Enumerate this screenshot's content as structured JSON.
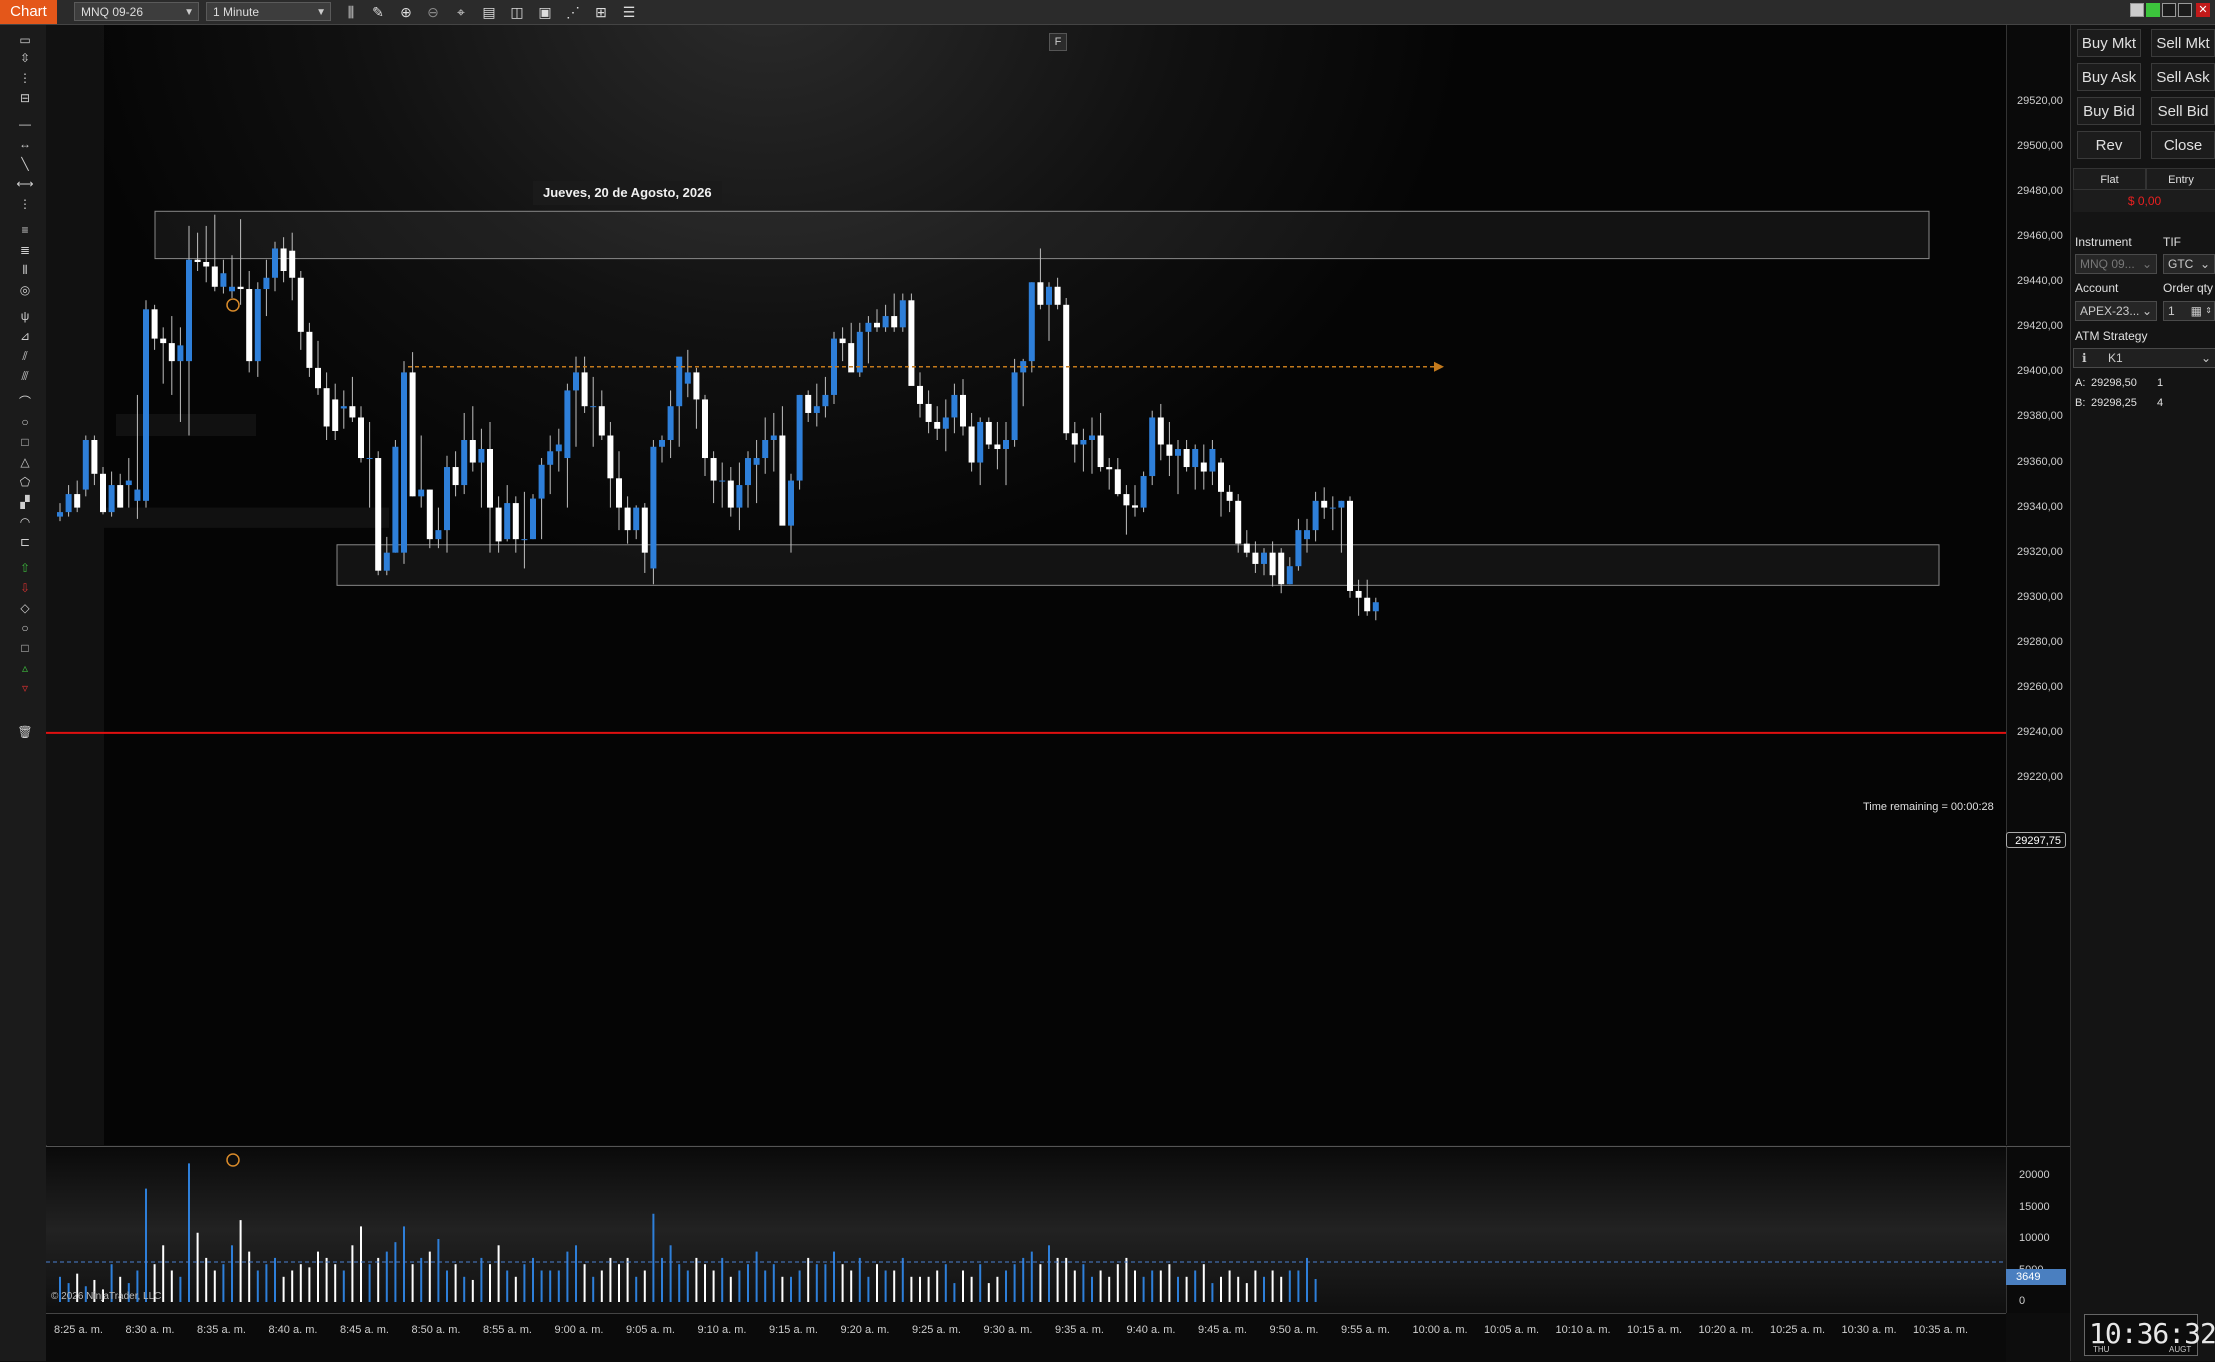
{
  "topbar": {
    "chart_tab": "Chart",
    "instrument": "MNQ 09-26",
    "interval": "1 Minute"
  },
  "chart": {
    "date_label": "Jueves, 20 de Agosto, 2026",
    "time_remaining": "Time remaining = 00:00:28",
    "last_price": "29297,75",
    "copyright": "© 2026 NinjaTrader, LLC",
    "f_button": "F",
    "price_ticks": [
      "29520,00",
      "29500,00",
      "29480,00",
      "29460,00",
      "29440,00",
      "29420,00",
      "29400,00",
      "29380,00",
      "29360,00",
      "29340,00",
      "29320,00",
      "29300,00",
      "29280,00",
      "29260,00",
      "29240,00",
      "29220,00"
    ],
    "volume_ticks": [
      "20000",
      "15000",
      "10000",
      "5000",
      "0"
    ],
    "volume_last": "3649",
    "time_ticks": [
      "8:25 a. m.",
      "8:30 a. m.",
      "8:35 a. m.",
      "8:40 a. m.",
      "8:45 a. m.",
      "8:50 a. m.",
      "8:55 a. m.",
      "9:00 a. m.",
      "9:05 a. m.",
      "9:10 a. m.",
      "9:15 a. m.",
      "9:20 a. m.",
      "9:25 a. m.",
      "9:30 a. m.",
      "9:35 a. m.",
      "9:40 a. m.",
      "9:45 a. m.",
      "9:50 a. m.",
      "9:55 a. m.",
      "10:00 a. m.",
      "10:05 a. m.",
      "10:10 a. m.",
      "10:15 a. m.",
      "10:20 a. m.",
      "10:25 a. m.",
      "10:30 a. m.",
      "10:35 a. m."
    ],
    "colors": {
      "up": "#2e7fd9",
      "down": "#ffffff",
      "stop_line": "#e01010",
      "zone": "#888888",
      "arrow": "#c47a1c"
    },
    "levels": {
      "red_line": 29240.0,
      "arrow_level": 29402.5,
      "top_zone": [
        29450.5,
        29471.5
      ],
      "bottom_zone": [
        29305.5,
        29323.5
      ],
      "left_zone": [
        29331,
        29340
      ]
    }
  },
  "chart_data": {
    "type": "candlestick",
    "price_range": [
      29210,
      29530
    ],
    "volume_range": [
      0,
      22000
    ],
    "candles": [
      {
        "o": 29336,
        "h": 29342,
        "l": 29334,
        "c": 29338
      },
      {
        "o": 29338,
        "h": 29350,
        "l": 29336,
        "c": 29346
      },
      {
        "o": 29346,
        "h": 29352,
        "l": 29338,
        "c": 29340
      },
      {
        "o": 29348,
        "h": 29372,
        "l": 29345,
        "c": 29370
      },
      {
        "o": 29370,
        "h": 29372,
        "l": 29350,
        "c": 29355
      },
      {
        "o": 29355,
        "h": 29358,
        "l": 29337,
        "c": 29338
      },
      {
        "o": 29338,
        "h": 29356,
        "l": 29336,
        "c": 29350
      },
      {
        "o": 29350,
        "h": 29355,
        "l": 29340,
        "c": 29340
      },
      {
        "o": 29350,
        "h": 29362,
        "l": 29340,
        "c": 29352
      },
      {
        "o": 29343,
        "h": 29390,
        "l": 29335,
        "c": 29348
      },
      {
        "o": 29343,
        "h": 29432,
        "l": 29340,
        "c": 29428
      },
      {
        "o": 29428,
        "h": 29430,
        "l": 29410,
        "c": 29415
      },
      {
        "o": 29415,
        "h": 29420,
        "l": 29395,
        "c": 29413
      },
      {
        "o": 29413,
        "h": 29425,
        "l": 29390,
        "c": 29405
      },
      {
        "o": 29405,
        "h": 29420,
        "l": 29378,
        "c": 29412
      },
      {
        "o": 29405,
        "h": 29465,
        "l": 29372,
        "c": 29450
      },
      {
        "o": 29450,
        "h": 29462,
        "l": 29445,
        "c": 29449
      },
      {
        "o": 29449,
        "h": 29465,
        "l": 29440,
        "c": 29447
      },
      {
        "o": 29447,
        "h": 29470,
        "l": 29436,
        "c": 29438
      },
      {
        "o": 29438,
        "h": 29450,
        "l": 29435,
        "c": 29444
      },
      {
        "o": 29436,
        "h": 29452,
        "l": 29433,
        "c": 29438
      },
      {
        "o": 29438,
        "h": 29468,
        "l": 29430,
        "c": 29437
      },
      {
        "o": 29437,
        "h": 29445,
        "l": 29400,
        "c": 29405
      },
      {
        "o": 29405,
        "h": 29440,
        "l": 29398,
        "c": 29437
      },
      {
        "o": 29437,
        "h": 29450,
        "l": 29425,
        "c": 29442
      },
      {
        "o": 29442,
        "h": 29458,
        "l": 29436,
        "c": 29455
      },
      {
        "o": 29455,
        "h": 29460,
        "l": 29440,
        "c": 29445
      },
      {
        "o": 29454,
        "h": 29462,
        "l": 29432,
        "c": 29442
      },
      {
        "o": 29442,
        "h": 29445,
        "l": 29410,
        "c": 29418
      },
      {
        "o": 29418,
        "h": 29422,
        "l": 29398,
        "c": 29402
      },
      {
        "o": 29402,
        "h": 29414,
        "l": 29390,
        "c": 29393
      },
      {
        "o": 29393,
        "h": 29400,
        "l": 29370,
        "c": 29376
      },
      {
        "o": 29388,
        "h": 29395,
        "l": 29370,
        "c": 29374
      },
      {
        "o": 29384,
        "h": 29392,
        "l": 29375,
        "c": 29385
      },
      {
        "o": 29385,
        "h": 29398,
        "l": 29378,
        "c": 29380
      },
      {
        "o": 29380,
        "h": 29385,
        "l": 29360,
        "c": 29362
      },
      {
        "o": 29362,
        "h": 29378,
        "l": 29340,
        "c": 29362
      },
      {
        "o": 29362,
        "h": 29365,
        "l": 29310,
        "c": 29312
      },
      {
        "o": 29312,
        "h": 29327,
        "l": 29310,
        "c": 29320
      },
      {
        "o": 29320,
        "h": 29370,
        "l": 29320,
        "c": 29367
      },
      {
        "o": 29320,
        "h": 29405,
        "l": 29315,
        "c": 29400
      },
      {
        "o": 29400,
        "h": 29409,
        "l": 29345,
        "c": 29345
      },
      {
        "o": 29345,
        "h": 29372,
        "l": 29340,
        "c": 29348
      },
      {
        "o": 29348,
        "h": 29348,
        "l": 29322,
        "c": 29326
      },
      {
        "o": 29326,
        "h": 29340,
        "l": 29322,
        "c": 29330
      },
      {
        "o": 29330,
        "h": 29363,
        "l": 29320,
        "c": 29358
      },
      {
        "o": 29358,
        "h": 29365,
        "l": 29345,
        "c": 29350
      },
      {
        "o": 29350,
        "h": 29382,
        "l": 29346,
        "c": 29370
      },
      {
        "o": 29370,
        "h": 29385,
        "l": 29356,
        "c": 29360
      },
      {
        "o": 29360,
        "h": 29375,
        "l": 29340,
        "c": 29366
      },
      {
        "o": 29366,
        "h": 29378,
        "l": 29320,
        "c": 29340
      },
      {
        "o": 29340,
        "h": 29345,
        "l": 29320,
        "c": 29325
      },
      {
        "o": 29326,
        "h": 29350,
        "l": 29325,
        "c": 29342
      },
      {
        "o": 29342,
        "h": 29345,
        "l": 29320,
        "c": 29326
      },
      {
        "o": 29326,
        "h": 29347,
        "l": 29313,
        "c": 29326
      },
      {
        "o": 29326,
        "h": 29346,
        "l": 29326,
        "c": 29344
      },
      {
        "o": 29344,
        "h": 29362,
        "l": 29326,
        "c": 29359
      },
      {
        "o": 29359,
        "h": 29372,
        "l": 29346,
        "c": 29365
      },
      {
        "o": 29365,
        "h": 29375,
        "l": 29356,
        "c": 29368
      },
      {
        "o": 29362,
        "h": 29395,
        "l": 29340,
        "c": 29392
      },
      {
        "o": 29392,
        "h": 29407,
        "l": 29367,
        "c": 29400
      },
      {
        "o": 29400,
        "h": 29407,
        "l": 29382,
        "c": 29385
      },
      {
        "o": 29385,
        "h": 29398,
        "l": 29367,
        "c": 29385
      },
      {
        "o": 29385,
        "h": 29392,
        "l": 29370,
        "c": 29372
      },
      {
        "o": 29372,
        "h": 29378,
        "l": 29340,
        "c": 29353
      },
      {
        "o": 29353,
        "h": 29365,
        "l": 29330,
        "c": 29340
      },
      {
        "o": 29340,
        "h": 29345,
        "l": 29324,
        "c": 29330
      },
      {
        "o": 29330,
        "h": 29341,
        "l": 29326,
        "c": 29340
      },
      {
        "o": 29340,
        "h": 29342,
        "l": 29311,
        "c": 29320
      },
      {
        "o": 29313,
        "h": 29370,
        "l": 29306,
        "c": 29367
      },
      {
        "o": 29367,
        "h": 29372,
        "l": 29360,
        "c": 29370
      },
      {
        "o": 29370,
        "h": 29392,
        "l": 29362,
        "c": 29385
      },
      {
        "o": 29385,
        "h": 29400,
        "l": 29367,
        "c": 29407
      },
      {
        "o": 29395,
        "h": 29410,
        "l": 29389,
        "c": 29400
      },
      {
        "o": 29400,
        "h": 29402,
        "l": 29375,
        "c": 29388
      },
      {
        "o": 29388,
        "h": 29390,
        "l": 29354,
        "c": 29362
      },
      {
        "o": 29362,
        "h": 29365,
        "l": 29342,
        "c": 29352
      },
      {
        "o": 29352,
        "h": 29360,
        "l": 29340,
        "c": 29352
      },
      {
        "o": 29352,
        "h": 29358,
        "l": 29336,
        "c": 29340
      },
      {
        "o": 29340,
        "h": 29360,
        "l": 29330,
        "c": 29350
      },
      {
        "o": 29350,
        "h": 29365,
        "l": 29340,
        "c": 29362
      },
      {
        "o": 29359,
        "h": 29370,
        "l": 29342,
        "c": 29362
      },
      {
        "o": 29362,
        "h": 29380,
        "l": 29355,
        "c": 29370
      },
      {
        "o": 29370,
        "h": 29382,
        "l": 29356,
        "c": 29372
      },
      {
        "o": 29372,
        "h": 29385,
        "l": 29336,
        "c": 29332
      },
      {
        "o": 29332,
        "h": 29355,
        "l": 29320,
        "c": 29352
      },
      {
        "o": 29352,
        "h": 29390,
        "l": 29348,
        "c": 29390
      },
      {
        "o": 29390,
        "h": 29392,
        "l": 29378,
        "c": 29382
      },
      {
        "o": 29382,
        "h": 29395,
        "l": 29376,
        "c": 29385
      },
      {
        "o": 29385,
        "h": 29398,
        "l": 29380,
        "c": 29390
      },
      {
        "o": 29390,
        "h": 29418,
        "l": 29386,
        "c": 29415
      },
      {
        "o": 29415,
        "h": 29420,
        "l": 29405,
        "c": 29413
      },
      {
        "o": 29413,
        "h": 29422,
        "l": 29403,
        "c": 29400
      },
      {
        "o": 29400,
        "h": 29422,
        "l": 29398,
        "c": 29418
      },
      {
        "o": 29418,
        "h": 29425,
        "l": 29404,
        "c": 29422
      },
      {
        "o": 29422,
        "h": 29428,
        "l": 29418,
        "c": 29420
      },
      {
        "o": 29420,
        "h": 29430,
        "l": 29418,
        "c": 29425
      },
      {
        "o": 29425,
        "h": 29435,
        "l": 29418,
        "c": 29420
      },
      {
        "o": 29420,
        "h": 29435,
        "l": 29418,
        "c": 29432
      },
      {
        "o": 29432,
        "h": 29435,
        "l": 29400,
        "c": 29394
      },
      {
        "o": 29394,
        "h": 29400,
        "l": 29380,
        "c": 29386
      },
      {
        "o": 29386,
        "h": 29392,
        "l": 29373,
        "c": 29378
      },
      {
        "o": 29378,
        "h": 29385,
        "l": 29370,
        "c": 29375
      },
      {
        "o": 29375,
        "h": 29388,
        "l": 29365,
        "c": 29380
      },
      {
        "o": 29380,
        "h": 29395,
        "l": 29373,
        "c": 29390
      },
      {
        "o": 29390,
        "h": 29397,
        "l": 29372,
        "c": 29376
      },
      {
        "o": 29376,
        "h": 29382,
        "l": 29356,
        "c": 29360
      },
      {
        "o": 29360,
        "h": 29380,
        "l": 29350,
        "c": 29378
      },
      {
        "o": 29378,
        "h": 29380,
        "l": 29366,
        "c": 29368
      },
      {
        "o": 29368,
        "h": 29378,
        "l": 29357,
        "c": 29366
      },
      {
        "o": 29366,
        "h": 29378,
        "l": 29350,
        "c": 29370
      },
      {
        "o": 29370,
        "h": 29406,
        "l": 29367,
        "c": 29400
      },
      {
        "o": 29400,
        "h": 29406,
        "l": 29385,
        "c": 29405
      },
      {
        "o": 29405,
        "h": 29440,
        "l": 29400,
        "c": 29440
      },
      {
        "o": 29440,
        "h": 29455,
        "l": 29428,
        "c": 29430
      },
      {
        "o": 29430,
        "h": 29440,
        "l": 29414,
        "c": 29438
      },
      {
        "o": 29438,
        "h": 29442,
        "l": 29428,
        "c": 29430
      },
      {
        "o": 29430,
        "h": 29433,
        "l": 29370,
        "c": 29373
      },
      {
        "o": 29373,
        "h": 29378,
        "l": 29360,
        "c": 29368
      },
      {
        "o": 29368,
        "h": 29375,
        "l": 29356,
        "c": 29370
      },
      {
        "o": 29370,
        "h": 29380,
        "l": 29355,
        "c": 29372
      },
      {
        "o": 29372,
        "h": 29382,
        "l": 29356,
        "c": 29358
      },
      {
        "o": 29358,
        "h": 29362,
        "l": 29348,
        "c": 29357
      },
      {
        "o": 29357,
        "h": 29362,
        "l": 29345,
        "c": 29346
      },
      {
        "o": 29346,
        "h": 29350,
        "l": 29328,
        "c": 29341
      },
      {
        "o": 29341,
        "h": 29350,
        "l": 29336,
        "c": 29340
      },
      {
        "o": 29340,
        "h": 29356,
        "l": 29338,
        "c": 29354
      },
      {
        "o": 29354,
        "h": 29383,
        "l": 29350,
        "c": 29380
      },
      {
        "o": 29380,
        "h": 29386,
        "l": 29361,
        "c": 29368
      },
      {
        "o": 29368,
        "h": 29378,
        "l": 29354,
        "c": 29363
      },
      {
        "o": 29363,
        "h": 29370,
        "l": 29346,
        "c": 29366
      },
      {
        "o": 29366,
        "h": 29370,
        "l": 29356,
        "c": 29358
      },
      {
        "o": 29358,
        "h": 29368,
        "l": 29348,
        "c": 29366
      },
      {
        "o": 29360,
        "h": 29368,
        "l": 29348,
        "c": 29356
      },
      {
        "o": 29356,
        "h": 29370,
        "l": 29350,
        "c": 29366
      },
      {
        "o": 29360,
        "h": 29362,
        "l": 29336,
        "c": 29347
      },
      {
        "o": 29347,
        "h": 29350,
        "l": 29338,
        "c": 29343
      },
      {
        "o": 29343,
        "h": 29346,
        "l": 29320,
        "c": 29324
      },
      {
        "o": 29324,
        "h": 29330,
        "l": 29318,
        "c": 29320
      },
      {
        "o": 29320,
        "h": 29325,
        "l": 29311,
        "c": 29315
      },
      {
        "o": 29315,
        "h": 29322,
        "l": 29310,
        "c": 29320
      },
      {
        "o": 29320,
        "h": 29325,
        "l": 29305,
        "c": 29310
      },
      {
        "o": 29320,
        "h": 29322,
        "l": 29302,
        "c": 29306
      },
      {
        "o": 29306,
        "h": 29318,
        "l": 29306,
        "c": 29314
      },
      {
        "o": 29314,
        "h": 29335,
        "l": 29312,
        "c": 29330
      },
      {
        "o": 29326,
        "h": 29335,
        "l": 29320,
        "c": 29330
      },
      {
        "o": 29330,
        "h": 29347,
        "l": 29325,
        "c": 29343
      },
      {
        "o": 29343,
        "h": 29349,
        "l": 29335,
        "c": 29340
      },
      {
        "o": 29340,
        "h": 29345,
        "l": 29330,
        "c": 29340
      },
      {
        "o": 29340,
        "h": 29343,
        "l": 29320,
        "c": 29343
      },
      {
        "o": 29343,
        "h": 29345,
        "l": 29300,
        "c": 29303
      },
      {
        "o": 29303,
        "h": 29308,
        "l": 29292,
        "c": 29300
      },
      {
        "o": 29300,
        "h": 29308,
        "l": 29292,
        "c": 29294
      },
      {
        "o": 29294,
        "h": 29300,
        "l": 29290,
        "c": 29298
      }
    ],
    "volumes": [
      4000,
      3000,
      4500,
      2500,
      3500,
      2000,
      6000,
      4000,
      3000,
      5000,
      18000,
      6000,
      9000,
      5000,
      4000,
      22000,
      11000,
      7000,
      5000,
      6000,
      9000,
      13000,
      8000,
      5000,
      6000,
      7000,
      4000,
      5000,
      6000,
      5500,
      8000,
      7000,
      6000,
      5000,
      9000,
      12000,
      6000,
      7000,
      8000,
      9500,
      12000,
      6000,
      7000,
      8000,
      10000,
      5000,
      6000,
      4000,
      3500,
      7000,
      6000,
      9000,
      5000,
      4000,
      6000,
      7000,
      5000,
      5000,
      5000,
      8000,
      9000,
      6000,
      4000,
      5000,
      7000,
      6000,
      7000,
      4000,
      5000,
      14000,
      7000,
      9000,
      6000,
      5000,
      7000,
      6000,
      5000,
      7000,
      4000,
      5000,
      6000,
      8000,
      5000,
      6000,
      4000,
      4000,
      5000,
      7000,
      6000,
      6000,
      8000,
      6000,
      5000,
      7000,
      4000,
      6000,
      5000,
      5000,
      7000,
      4000,
      4000,
      4000,
      5000,
      6000,
      3000,
      5000,
      4000,
      6000,
      3000,
      4000,
      5000,
      6000,
      7000,
      8000,
      6000,
      9000,
      7000,
      7000,
      5000,
      6000,
      4000,
      5000,
      4000,
      6000,
      7000,
      5000,
      4000,
      5000,
      5000,
      6000,
      4000,
      4000,
      5000,
      6000,
      3000,
      4000,
      5000,
      4000,
      3000,
      5000,
      4000,
      5000,
      4000,
      5000,
      5000,
      7000,
      3649
    ]
  },
  "rightpanel": {
    "buy_mkt": "Buy Mkt",
    "sell_mkt": "Sell Mkt",
    "buy_ask": "Buy Ask",
    "sell_ask": "Sell Ask",
    "buy_bid": "Buy Bid",
    "sell_bid": "Sell Bid",
    "rev": "Rev",
    "close": "Close",
    "flat": "Flat",
    "entry": "Entry",
    "pnl": "$ 0,00",
    "instrument_label": "Instrument",
    "tif_label": "TIF",
    "instrument_value": "MNQ 09...",
    "tif_value": "GTC",
    "account_label": "Account",
    "order_qty_label": "Order qty",
    "account_value": "APEX-23...",
    "order_qty_value": "1",
    "atm_label": "ATM Strategy",
    "atm_value": "K1",
    "ask_label": "A:",
    "ask_price": "29298,50",
    "ask_size": "1",
    "bid_label": "B:",
    "bid_price": "29298,25",
    "bid_size": "4"
  },
  "clock": {
    "time": "10:36:32",
    "day": "THU",
    "month": "AUGT"
  }
}
